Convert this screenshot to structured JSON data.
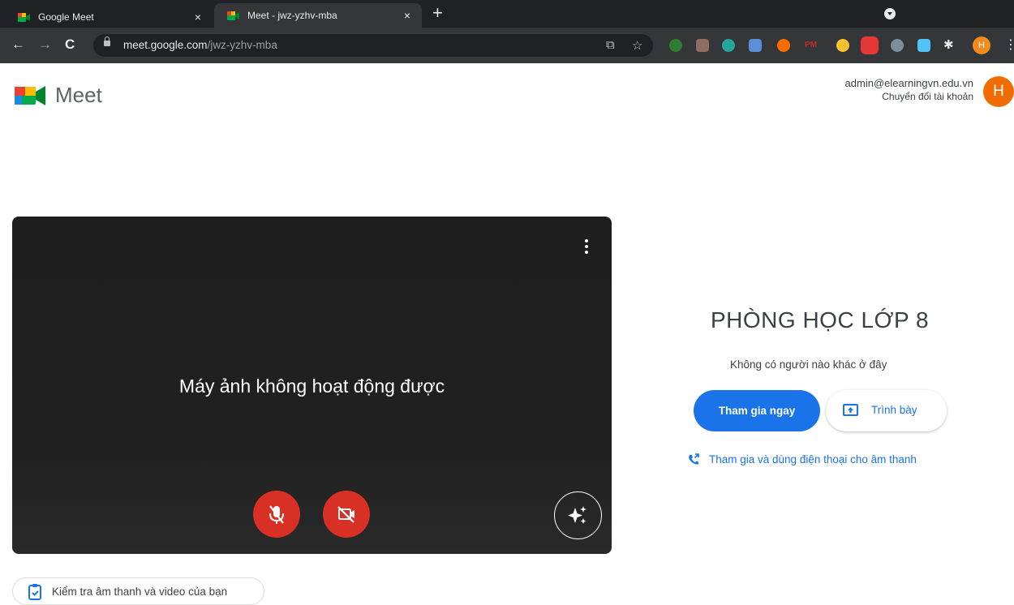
{
  "browser": {
    "tabs": [
      {
        "title": "Google Meet",
        "close": "×"
      },
      {
        "title": "Meet - jwz-yzhv-mba",
        "close": "×"
      }
    ],
    "new_tab": "+",
    "url_host": "meet.google.com",
    "url_path": "/jwz-yzhv-mba",
    "profile_initial": "H",
    "extensions": [
      "PM"
    ]
  },
  "header": {
    "brand": "Meet",
    "account_email": "admin@elearningvn.edu.vn",
    "switch_account": "Chuyển đổi tài khoản",
    "avatar_initial": "H",
    "avatar_color": "#ef6c00"
  },
  "preview": {
    "message": "Máy ảnh không hoạt động được",
    "mic_state": "off",
    "camera_state": "off",
    "button_color": "#d93025"
  },
  "room": {
    "title": "PHÒNG HỌC LỚP 8",
    "status": "Không có người nào khác ở đây",
    "join_label": "Tham gia ngay",
    "present_label": "Trình bày",
    "phone_label": "Tham gia và dùng điện thoại cho âm thanh",
    "accent": "#1a73e8"
  },
  "footer": {
    "check_label": "Kiểm tra âm thanh và video của bạn"
  }
}
